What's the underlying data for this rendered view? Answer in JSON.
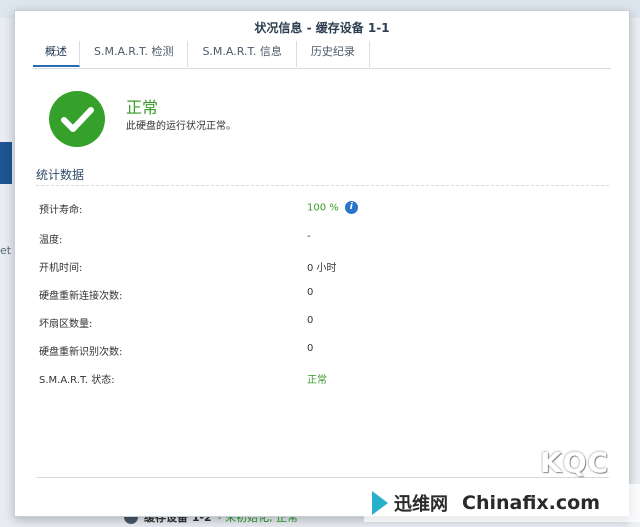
{
  "dialog": {
    "title": "状况信息 - 缓存设备 1-1",
    "tabs": [
      {
        "label": "概述",
        "active": true
      },
      {
        "label": "S.M.A.R.T. 检测",
        "active": false
      },
      {
        "label": "S.M.A.R.T. 信息",
        "active": false
      },
      {
        "label": "历史纪录",
        "active": false
      }
    ]
  },
  "status": {
    "icon": "check-circle-icon",
    "title": "正常",
    "description": "此硬盘的运行状况正常。",
    "color": "#3a9a2a"
  },
  "stats": {
    "section_title": "统计数据",
    "rows": [
      {
        "label": "预计寿命:",
        "value": "100 %",
        "has_info_icon": true
      },
      {
        "label": "温度:",
        "value": "-"
      },
      {
        "label": "开机时间:",
        "value": "0 小时"
      },
      {
        "label": "硬盘重新连接次数:",
        "value": "0"
      },
      {
        "label": "坏扇区数量:",
        "value": "0"
      },
      {
        "label": "硬盘重新识别次数:",
        "value": "0"
      },
      {
        "label": "S.M.A.R.T. 状态:",
        "value": "正常"
      }
    ]
  },
  "background": {
    "left_text": "et",
    "bottom_item_name": "缓存设备 1-2",
    "bottom_item_status": "- 未初始化, 正常"
  },
  "watermark": {
    "logo": "KQC",
    "brand_cn": "迅维网",
    "brand_en": "Chinafix.com"
  }
}
